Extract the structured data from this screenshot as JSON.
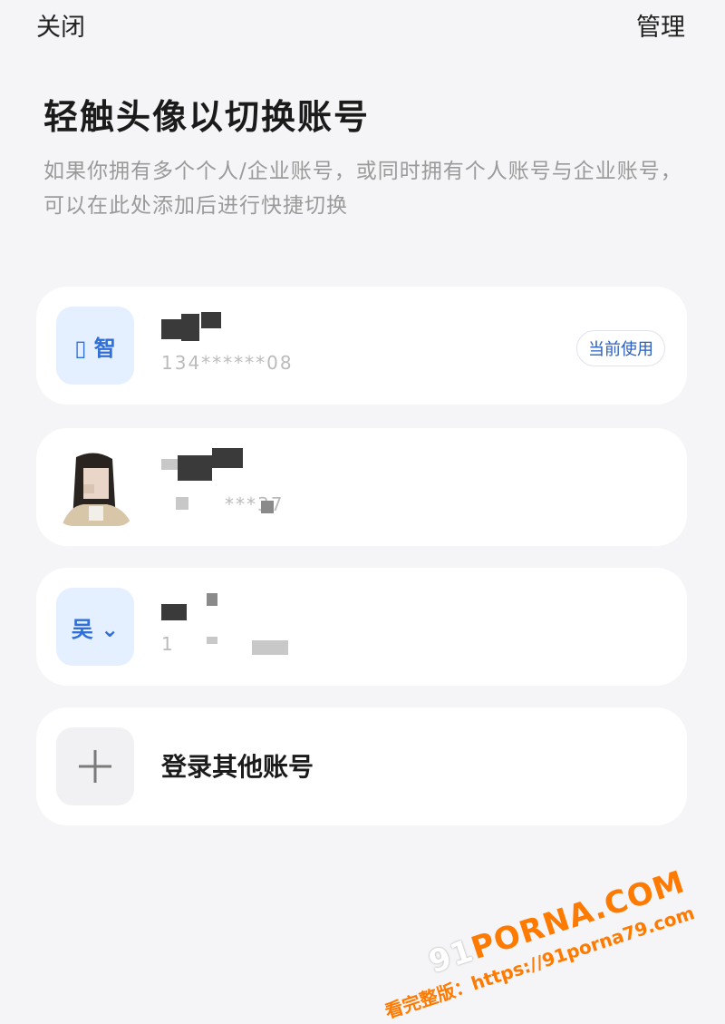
{
  "topbar": {
    "close": "关闭",
    "manage": "管理"
  },
  "title": "轻触头像以切换账号",
  "description": "如果你拥有多个个人/企业账号，或同时拥有个人账号与企业账号，可以在此处添加后进行快捷切换",
  "accounts": [
    {
      "avatar_text": "▯ 智",
      "name": "",
      "id": "134******08",
      "badge": "当前使用"
    },
    {
      "avatar_text": "",
      "name": "",
      "id": "***37"
    },
    {
      "avatar_text": "吴 ⌄",
      "name": "",
      "id": "1"
    }
  ],
  "add_account": {
    "icon": "plus-icon",
    "label": "登录其他账号"
  },
  "watermark": {
    "logo_prefix": "91",
    "logo": "PORNA.COM",
    "url": "看完整版：https://91porna79.com"
  }
}
